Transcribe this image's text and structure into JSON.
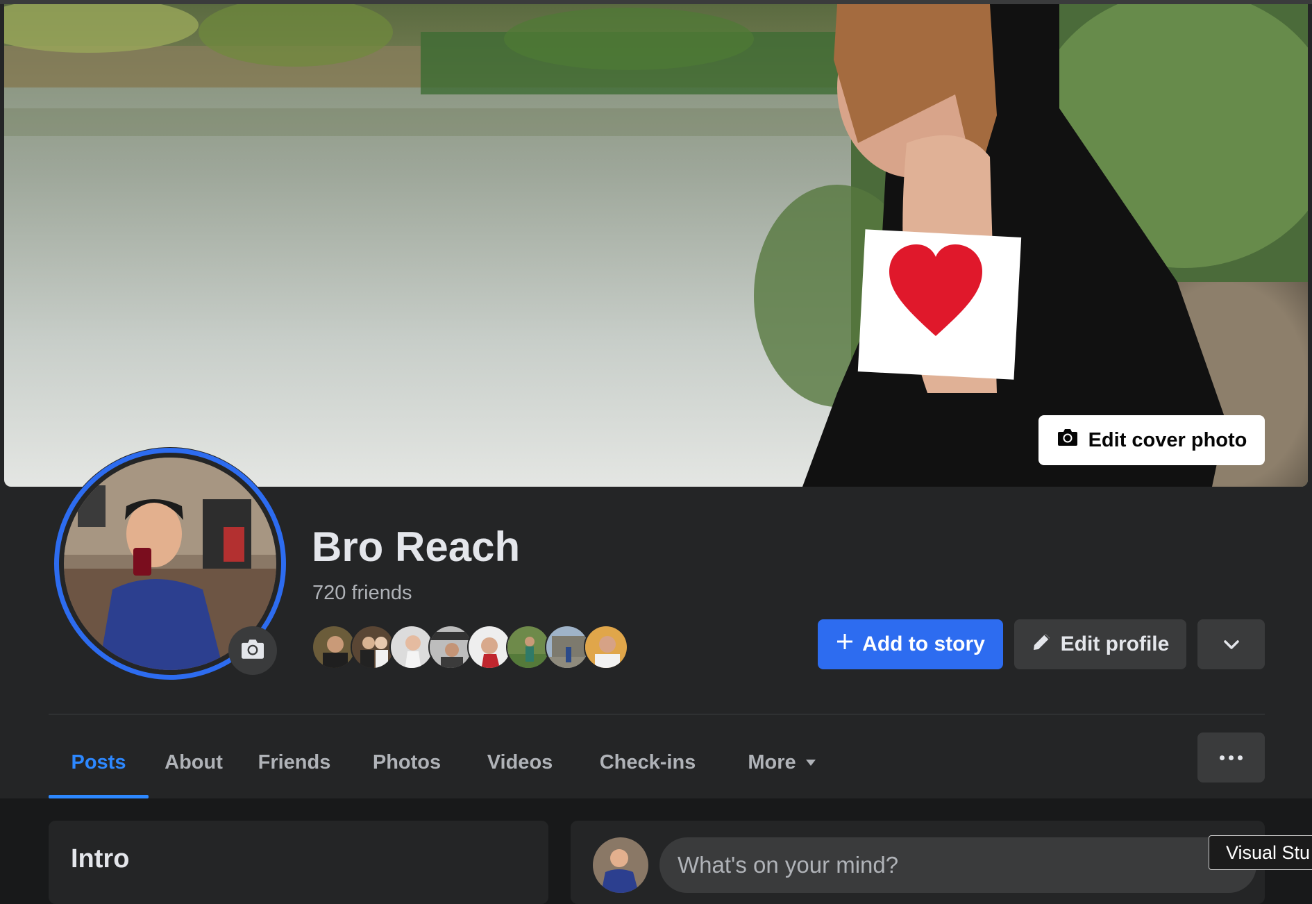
{
  "cover": {
    "edit_cover_label": "Edit cover photo"
  },
  "profile": {
    "name": "Bro Reach",
    "friends_count": "720 friends",
    "friend_avatar_count": 8
  },
  "actions": {
    "add_to_story_label": "Add to story",
    "edit_profile_label": "Edit profile"
  },
  "tabs": [
    {
      "label": "Posts",
      "active": true
    },
    {
      "label": "About",
      "active": false
    },
    {
      "label": "Friends",
      "active": false
    },
    {
      "label": "Photos",
      "active": false
    },
    {
      "label": "Videos",
      "active": false
    },
    {
      "label": "Check-ins",
      "active": false
    },
    {
      "label": "More",
      "active": false
    }
  ],
  "intro": {
    "title": "Intro"
  },
  "composer": {
    "placeholder": "What's on your mind?"
  },
  "tooltip": {
    "text": "Visual Stu"
  },
  "colors": {
    "accent": "#2d88ff",
    "primary_button": "#2d6cf0",
    "background": "#18191a",
    "surface": "#242526",
    "secondary_button": "#3a3b3c"
  },
  "icons": {
    "edit_cover": "camera-icon",
    "avatar_edit": "camera-icon",
    "add_story": "plus-icon",
    "edit_profile": "pencil-icon",
    "more": "chevron-down-icon",
    "tabs_more": "caret-down-icon",
    "options": "ellipsis-icon"
  }
}
